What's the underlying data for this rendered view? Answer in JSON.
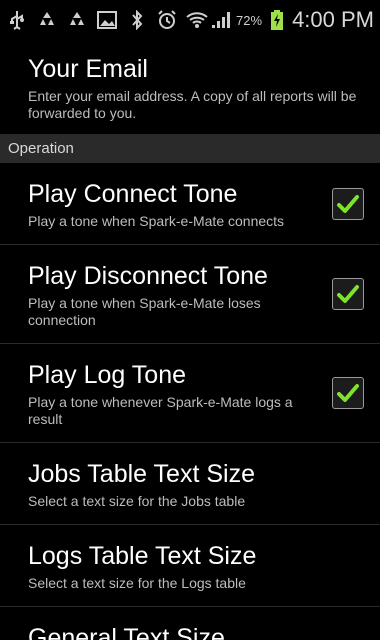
{
  "status_bar": {
    "battery_percent": "72%",
    "time": "4:00 PM",
    "icons": [
      "usb-icon",
      "recycle-icon",
      "recycle-icon",
      "image-icon",
      "bluetooth-icon",
      "alarm-icon",
      "wifi-icon",
      "signal-icon",
      "battery-charging-icon"
    ]
  },
  "email_pref": {
    "title": "Your Email",
    "summary": "Enter your email address.  A copy of all reports will be forwarded to you."
  },
  "category_operation": "Operation",
  "prefs": [
    {
      "title": "Play Connect Tone",
      "summary": "Play a tone when Spark-e-Mate connects",
      "checked": true
    },
    {
      "title": "Play Disconnect Tone",
      "summary": "Play a tone when Spark-e-Mate loses connection",
      "checked": true
    },
    {
      "title": "Play Log Tone",
      "summary": "Play a tone whenever Spark-e-Mate logs a result",
      "checked": true
    }
  ],
  "size_prefs": [
    {
      "title": "Jobs Table Text Size",
      "summary": "Select a text size for the Jobs table"
    },
    {
      "title": "Logs Table Text Size",
      "summary": "Select a text size for the Logs table"
    },
    {
      "title": "General Text Size",
      "summary": ""
    }
  ],
  "colors": {
    "check": "#7ee32a",
    "category_bg": "#2a2a2a"
  }
}
